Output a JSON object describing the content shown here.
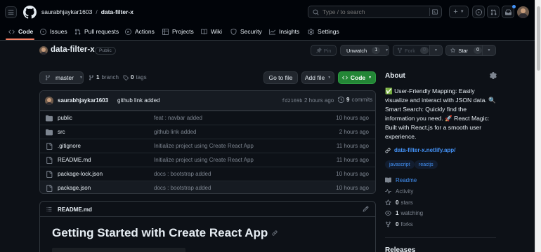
{
  "header": {
    "owner": "saurabhjaykar1603",
    "separator": "/",
    "repo": "data-filter-x",
    "search_placeholder": "Type / to search",
    "plus_label": "+"
  },
  "tabs": [
    {
      "label": "Code"
    },
    {
      "label": "Issues"
    },
    {
      "label": "Pull requests"
    },
    {
      "label": "Actions"
    },
    {
      "label": "Projects"
    },
    {
      "label": "Wiki"
    },
    {
      "label": "Security"
    },
    {
      "label": "Insights"
    },
    {
      "label": "Settings"
    }
  ],
  "repo": {
    "name": "data-filter-x",
    "visibility": "Public",
    "pin_label": "Pin",
    "unwatch_label": "Unwatch",
    "unwatch_count": "1",
    "fork_label": "Fork",
    "fork_count": "0",
    "star_label": "Star",
    "star_count": "0"
  },
  "toolbar": {
    "branch": "master",
    "branch_count": "1",
    "branch_label": "branch",
    "tag_count": "0",
    "tag_label": "tags",
    "goto_file": "Go to file",
    "add_file": "Add file",
    "code": "Code"
  },
  "commit": {
    "author": "saurabhjaykar1603",
    "message": "github link added",
    "sha": "fd2169b",
    "time": "2 hours ago",
    "count": "9",
    "count_label": "commits"
  },
  "files": [
    {
      "name": "public",
      "type": "dir",
      "message": "feat : navbar added",
      "time": "10 hours ago"
    },
    {
      "name": "src",
      "type": "dir",
      "message": "github link added",
      "time": "2 hours ago"
    },
    {
      "name": ".gitignore",
      "type": "file",
      "message": "Initialize project using Create React App",
      "time": "11 hours ago"
    },
    {
      "name": "README.md",
      "type": "file",
      "message": "Initialize project using Create React App",
      "time": "11 hours ago"
    },
    {
      "name": "package-lock.json",
      "type": "file",
      "message": "docs : bootstrap added",
      "time": "10 hours ago"
    },
    {
      "name": "package.json",
      "type": "file",
      "message": "docs : bootstrap added",
      "time": "10 hours ago"
    }
  ],
  "readme": {
    "filename": "README.md",
    "heading": "Getting Started with Create React App"
  },
  "about": {
    "title": "About",
    "description_lines": [
      "✅ User-Friendly Mapping: Easily",
      "visualize and interact with JSON data. 🔍",
      "Smart Search: Quickly find the",
      "information you need. 🚀 React Magic:",
      "Built with React.js for a smooth user",
      "experience."
    ],
    "link": "data-filter-x.netlify.app/",
    "topics": [
      "javascript",
      "reactjs"
    ],
    "readme_label": "Readme",
    "activity_label": "Activity",
    "stars_count": "0",
    "stars_label": "stars",
    "watching_count": "1",
    "watching_label": "watching",
    "forks_count": "0",
    "forks_label": "forks",
    "releases_label": "Releases"
  },
  "colors": {
    "bg": "#0d1117",
    "header_bg": "#010409",
    "accent_tab": "#f78166",
    "link": "#4493f8",
    "green_button": "#238636"
  }
}
